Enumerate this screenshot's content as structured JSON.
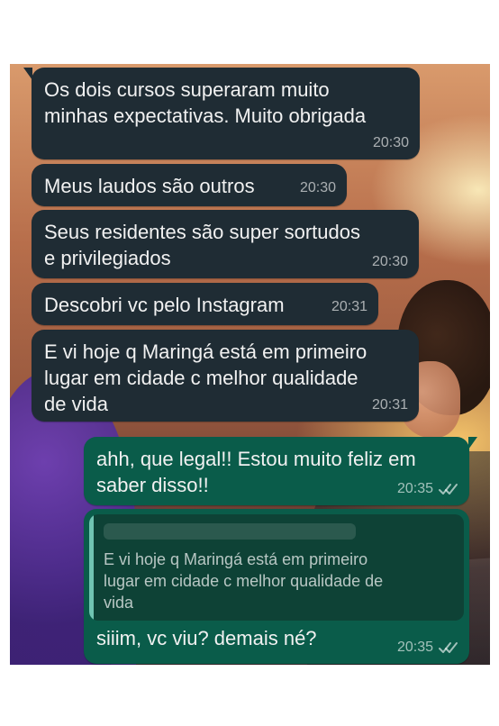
{
  "messages": [
    {
      "direction": "incoming",
      "text": "Os dois cursos superaram muito\nminhas expectativas. Muito obrigada",
      "time": "20:30"
    },
    {
      "direction": "incoming",
      "text": "Meus laudos são outros",
      "time": "20:30"
    },
    {
      "direction": "incoming",
      "text": "Seus residentes são super sortudos\ne privilegiados",
      "time": "20:30"
    },
    {
      "direction": "incoming",
      "text": "Descobri vc pelo Instagram",
      "time": "20:31"
    },
    {
      "direction": "incoming",
      "text": "E vi hoje q Maringá está em primeiro\nlugar em cidade c melhor qualidade\nde vida",
      "time": "20:31"
    },
    {
      "direction": "outgoing",
      "text": "ahh, que legal!! Estou muito feliz em\nsaber disso!!",
      "time": "20:35",
      "status_icon": "double-check-icon"
    },
    {
      "direction": "outgoing",
      "quoted_text": "E vi hoje q Maringá está em primeiro\nlugar em cidade c melhor qualidade de\nvida",
      "text": "siiim, vc viu? demais né?",
      "time": "20:35",
      "status_icon": "double-check-icon"
    }
  ],
  "colors": {
    "incoming_bubble": "#1f2c34",
    "outgoing_bubble": "#0a5c4a",
    "quote_box": "#0e4236",
    "quote_bar": "#7bd3c0",
    "text": "#f1f1f1"
  }
}
